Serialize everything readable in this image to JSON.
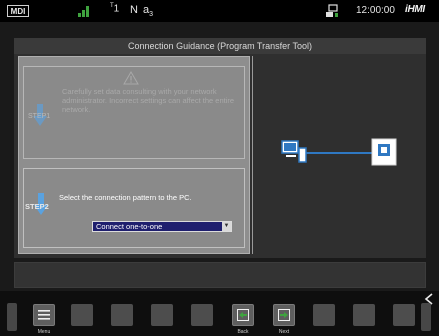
{
  "status_bar": {
    "mode": "MDI",
    "t_sup": "T",
    "t_num": "1",
    "n": "N",
    "a": "a",
    "a_sub": "3",
    "time": "12:00:00",
    "logo": "iHMI"
  },
  "window": {
    "title": "Connection Guidance (Program Transfer Tool)"
  },
  "step1": {
    "label": "STEP1",
    "warning_text": "Carefully set data consulting with your network administrator. Incorrect settings can affect the entire network."
  },
  "step2": {
    "label": "STEP2",
    "instruction": "Select the connection pattern to the PC.",
    "selected_pattern": "Connect one-to-one"
  },
  "softkeys": {
    "menu_label": "Menu",
    "back_label": "Back",
    "next_label": "Next"
  },
  "icons": {
    "signal": "signal-bars-icon",
    "network": "network-icon",
    "warning": "warning-triangle-icon",
    "arrow": "down-arrow-icon",
    "menu": "hamburger-menu-icon",
    "back": "back-icon",
    "next": "next-icon",
    "chevron": "chevron-left-icon"
  },
  "colors": {
    "accent_green": "#3fa33f",
    "select_bg": "#1f1f6e",
    "diagram_blue": "#2f78c2",
    "arrow_blue": "#5aa2e0"
  }
}
